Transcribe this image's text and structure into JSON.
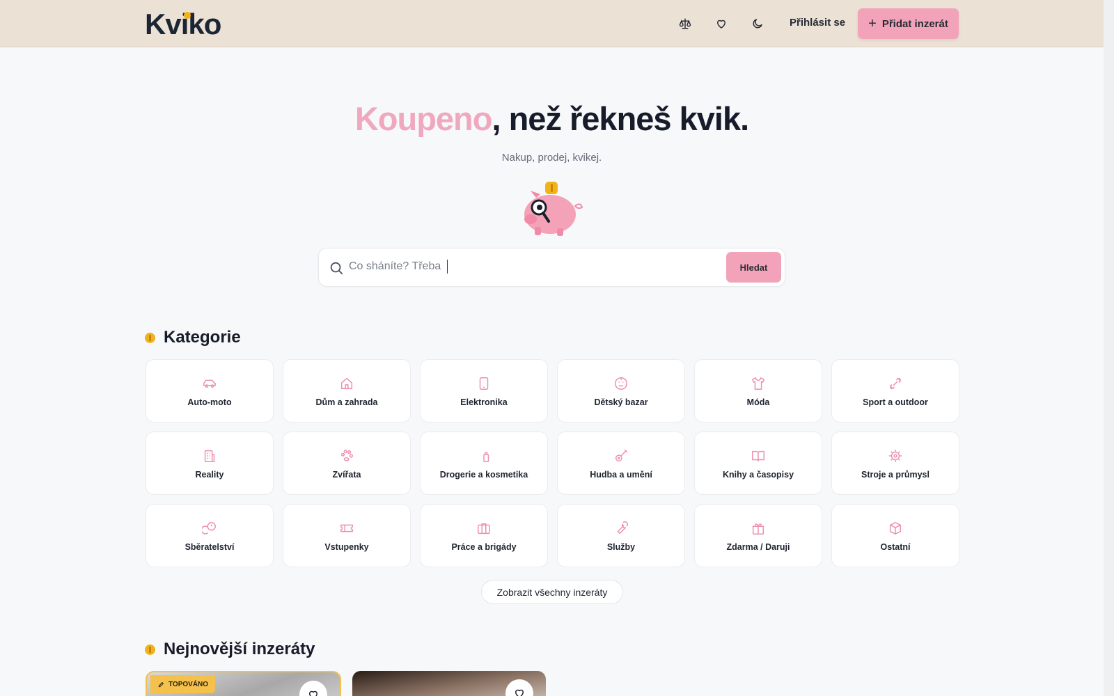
{
  "header": {
    "logo": "Kviko",
    "icons": [
      "scale-icon",
      "heart-icon",
      "moon-icon"
    ],
    "login_label": "Přihlásit se",
    "add_label": "Přidat inzerát"
  },
  "hero": {
    "title_accent": "Koupeno",
    "title_rest": ", než řekneš kvik.",
    "subtitle": "Nakup, prodej, kvikej."
  },
  "search": {
    "placeholder": "Co sháníte? Třeba",
    "button_label": "Hledat"
  },
  "categories": {
    "title": "Kategorie",
    "items": [
      {
        "label": "Auto-moto",
        "icon": "car-icon"
      },
      {
        "label": "Dům a zahrada",
        "icon": "house-icon"
      },
      {
        "label": "Elektronika",
        "icon": "phone-icon"
      },
      {
        "label": "Dětský bazar",
        "icon": "baby-icon"
      },
      {
        "label": "Móda",
        "icon": "shirt-icon"
      },
      {
        "label": "Sport a outdoor",
        "icon": "dumbbell-icon"
      },
      {
        "label": "Reality",
        "icon": "building-icon"
      },
      {
        "label": "Zvířata",
        "icon": "paw-icon"
      },
      {
        "label": "Drogerie a kosmetika",
        "icon": "spray-icon"
      },
      {
        "label": "Hudba a umění",
        "icon": "guitar-icon"
      },
      {
        "label": "Knihy a časopisy",
        "icon": "book-icon"
      },
      {
        "label": "Stroje a průmysl",
        "icon": "cog-icon"
      },
      {
        "label": "Sběratelství",
        "icon": "coins-icon"
      },
      {
        "label": "Vstupenky",
        "icon": "ticket-icon"
      },
      {
        "label": "Práce a brigády",
        "icon": "briefcase-icon"
      },
      {
        "label": "Služby",
        "icon": "wrench-icon"
      },
      {
        "label": "Zdarma / Daruji",
        "icon": "gift-icon"
      },
      {
        "label": "Ostatní",
        "icon": "box-icon"
      }
    ],
    "show_all_label": "Zobrazit všechny inzeráty"
  },
  "latest": {
    "title": "Nejnovější inzeráty",
    "badge": "TOPOVÁNO"
  },
  "colors": {
    "accent_pink": "#f2a3b9",
    "coin_yellow": "#efb21d",
    "header_bg": "#ebe1d4"
  }
}
